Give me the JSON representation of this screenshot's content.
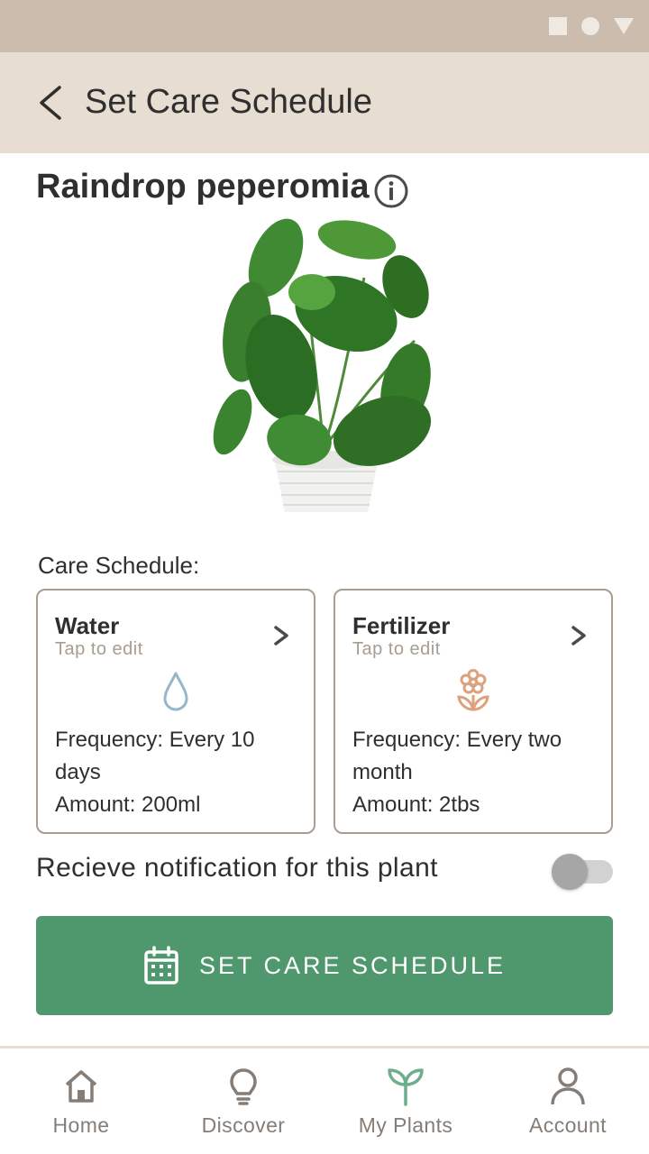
{
  "status_bar": {
    "icons": [
      "square-icon",
      "circle-icon",
      "triangle-icon"
    ]
  },
  "header": {
    "title": "Set Care Schedule",
    "back_icon": "back-chevron-icon"
  },
  "plant": {
    "name": "Raindrop peperomia",
    "info_icon": "info-icon"
  },
  "care": {
    "label": "Care Schedule:",
    "cards": [
      {
        "title": "Water",
        "subtitle": "Tap to edit",
        "icon": "water-drop-icon",
        "frequency": "Frequency: Every 10 days",
        "amount": "Amount: 200ml"
      },
      {
        "title": "Fertilizer",
        "subtitle": "Tap to edit",
        "icon": "flower-icon",
        "frequency": "Frequency: Every two month",
        "amount": "Amount: 2tbs"
      }
    ]
  },
  "notification": {
    "label": "Recieve notification for this plant",
    "enabled": false
  },
  "cta": {
    "label": "SET CARE SCHEDULE",
    "icon": "calendar-icon"
  },
  "nav": {
    "items": [
      {
        "label": "Home",
        "icon": "home-icon",
        "active": false
      },
      {
        "label": "Discover",
        "icon": "lightbulb-icon",
        "active": false
      },
      {
        "label": "My Plants",
        "icon": "sprout-icon",
        "active": true
      },
      {
        "label": "Account",
        "icon": "person-icon",
        "active": false
      }
    ]
  },
  "colors": {
    "status_bar": "#cbbcad",
    "app_bar": "#e7ddd1",
    "primary": "#4f976c",
    "water": "#95b7c9",
    "fertilizer": "#dca27e",
    "nav_active": "#6fae8d",
    "nav_inactive": "#857d76"
  }
}
